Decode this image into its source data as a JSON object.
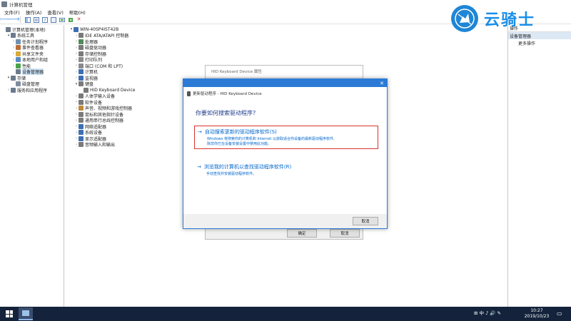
{
  "window": {
    "title": "计算机管理"
  },
  "menu": [
    "文件(F)",
    "操作(A)",
    "查看(V)",
    "帮助(H)"
  ],
  "toolbar": {
    "back": "🡐",
    "forward": "🡒",
    "delete": "✕"
  },
  "left_tree": [
    {
      "label": "计算机管理(本地)",
      "level": 0,
      "arrow": "",
      "icon_color": "#6d7a8a"
    },
    {
      "label": "系统工具",
      "level": 1,
      "arrow": "▾",
      "icon_color": "#6b7a8f"
    },
    {
      "label": "任务计划程序",
      "level": 2,
      "arrow": "›",
      "icon_color": "#6f8fb0"
    },
    {
      "label": "事件查看器",
      "level": 2,
      "arrow": "›",
      "icon_color": "#b96c3a"
    },
    {
      "label": "共享文件夹",
      "level": 2,
      "arrow": "›",
      "icon_color": "#d9a93a"
    },
    {
      "label": "本地用户和组",
      "level": 2,
      "arrow": "›",
      "icon_color": "#5a8ac4"
    },
    {
      "label": "性能",
      "level": 2,
      "arrow": "›",
      "icon_color": "#4aa34a"
    },
    {
      "label": "设备管理器",
      "level": 2,
      "arrow": "",
      "icon_color": "#6d7a8a",
      "selected": true
    },
    {
      "label": "存储",
      "level": 1,
      "arrow": "▾",
      "icon_color": "#6b7a8f"
    },
    {
      "label": "磁盘管理",
      "level": 2,
      "arrow": "",
      "icon_color": "#7d8ca0"
    },
    {
      "label": "服务和应用程序",
      "level": 1,
      "arrow": "›",
      "icon_color": "#6b7a8f"
    }
  ],
  "device_tree": [
    {
      "label": "WIN-40SP4IST42B",
      "level": 0,
      "arrow": "▾",
      "icon_color": "#3d6fb3"
    },
    {
      "label": "IDE ATA/ATAPI 控制器",
      "level": 1,
      "arrow": "›",
      "icon_color": "#7a7a7a"
    },
    {
      "label": "处理器",
      "level": 1,
      "arrow": "›",
      "icon_color": "#4f8a5a"
    },
    {
      "label": "磁盘驱动器",
      "level": 1,
      "arrow": "›",
      "icon_color": "#7a7a7a"
    },
    {
      "label": "存储控制器",
      "level": 1,
      "arrow": "›",
      "icon_color": "#7a7a7a"
    },
    {
      "label": "打印队列",
      "level": 1,
      "arrow": "›",
      "icon_color": "#8a8a8a"
    },
    {
      "label": "端口 (COM 和 LPT)",
      "level": 1,
      "arrow": "›",
      "icon_color": "#8a8a8a"
    },
    {
      "label": "计算机",
      "level": 1,
      "arrow": "›",
      "icon_color": "#3d6fb3"
    },
    {
      "label": "监视器",
      "level": 1,
      "arrow": "›",
      "icon_color": "#3d6fb3"
    },
    {
      "label": "键盘",
      "level": 1,
      "arrow": "▾",
      "icon_color": "#7a7a7a"
    },
    {
      "label": "HID Keyboard Device",
      "level": 2,
      "arrow": "",
      "icon_color": "#7a7a7a"
    },
    {
      "label": "人体学输入设备",
      "level": 1,
      "arrow": "›",
      "icon_color": "#7a7a7a"
    },
    {
      "label": "软件设备",
      "level": 1,
      "arrow": "›",
      "icon_color": "#7a7a7a"
    },
    {
      "label": "声音、视频和游戏控制器",
      "level": 1,
      "arrow": "›",
      "icon_color": "#c08a3a"
    },
    {
      "label": "鼠标和其他指针设备",
      "level": 1,
      "arrow": "›",
      "icon_color": "#7a7a7a"
    },
    {
      "label": "通用串行总线控制器",
      "level": 1,
      "arrow": "›",
      "icon_color": "#7a7a7a"
    },
    {
      "label": "网络适配器",
      "level": 1,
      "arrow": "›",
      "icon_color": "#3d6fb3"
    },
    {
      "label": "系统设备",
      "level": 1,
      "arrow": "›",
      "icon_color": "#3d6fb3"
    },
    {
      "label": "显示适配器",
      "level": 1,
      "arrow": "›",
      "icon_color": "#3d6fb3"
    },
    {
      "label": "音频输入和输出",
      "level": 1,
      "arrow": "›",
      "icon_color": "#7a7a7a"
    }
  ],
  "actions": {
    "header": "操作",
    "section": "设备管理器",
    "more": "更多操作"
  },
  "watermark": {
    "text": "云骑士"
  },
  "props_dialog": {
    "title": "HID Keyboard Device 属性",
    "ok": "确定",
    "cancel": "取消"
  },
  "update_dialog": {
    "header": "更新驱动程序 - HID Keyboard Device",
    "question": "你要如何搜索驱动程序?",
    "option1": {
      "title": "自动搜索更新的驱动程序软件(S)",
      "desc1": "Windows 将搜索你的计算机和 Internet 以获取适合你设备的最新驱动程序软件,",
      "desc2": "除非你已在设备安装设置中禁用此功能。"
    },
    "option2": {
      "title": "浏览我的计算机以查找驱动程序软件(R)",
      "desc": "手动查找并安装驱动程序软件。"
    },
    "cancel": "取消"
  },
  "taskbar": {
    "time": "10:27",
    "date": "2019/10/23",
    "ime": "中",
    "tray_icons": "⊞ 中 ♪ 🔊 ✎"
  },
  "colors": {
    "accent": "#2b7bd6",
    "link": "#0066cc",
    "highlight_box": "#d8342c",
    "taskbar": "#14233b"
  }
}
